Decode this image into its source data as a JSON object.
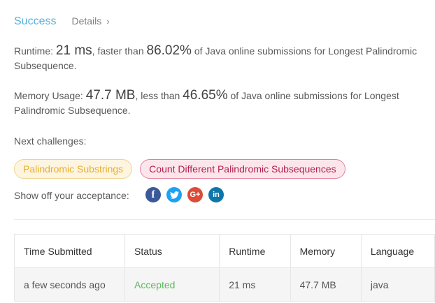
{
  "header": {
    "status": "Success",
    "details_label": "Details",
    "details_chevron": "›"
  },
  "runtime": {
    "label": "Runtime: ",
    "value": "21 ms",
    "comparison": ", faster than ",
    "percentile": "86.02%",
    "suffix": " of Java online submissions for Longest Palindromic Subsequence."
  },
  "memory": {
    "label": "Memory Usage: ",
    "value": "47.7 MB",
    "comparison": ", less than ",
    "percentile": "46.65%",
    "suffix": " of Java online submissions for Longest Palindromic Subsequence."
  },
  "next_challenges": {
    "label": "Next challenges:",
    "items": [
      {
        "label": "Palindromic Substrings",
        "difficulty": "easy",
        "color": "#e9ae2c"
      },
      {
        "label": "Count Different Palindromic Subsequences",
        "difficulty": "hard",
        "color": "#b3204f"
      }
    ]
  },
  "share": {
    "label": "Show off your acceptance:",
    "icons": [
      "facebook-icon",
      "twitter-icon",
      "google-plus-icon",
      "linkedin-icon"
    ],
    "fb_glyph": "f",
    "gp_glyph": "G+",
    "li_glyph": "in"
  },
  "table": {
    "headers": [
      "Time Submitted",
      "Status",
      "Runtime",
      "Memory",
      "Language"
    ],
    "rows": [
      {
        "time": "a few seconds ago",
        "status": "Accepted",
        "runtime": "21 ms",
        "memory": "47.7 MB",
        "language": "java"
      }
    ]
  },
  "colors": {
    "success": "#5ab0d8",
    "accepted": "#5cb85c"
  }
}
